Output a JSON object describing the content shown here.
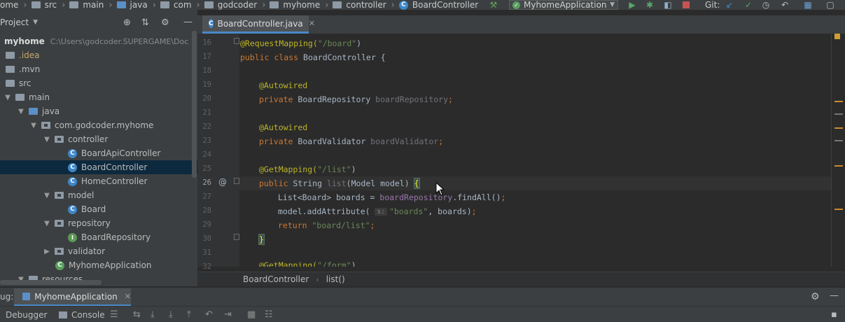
{
  "navbar": {
    "crumbs": [
      "ome",
      "src",
      "main",
      "java",
      "com",
      "godcoder",
      "myhome",
      "controller",
      "BoardController"
    ],
    "run_config": "MyhomeApplication",
    "git_label": "Git:"
  },
  "project": {
    "header": "Project",
    "root_name": "myhome",
    "root_path": "C:\\Users\\godcoder.SUPERGAME\\Doc",
    "tree": [
      {
        "label": ".idea"
      },
      {
        "label": ".mvn"
      },
      {
        "label": "src"
      },
      {
        "label": "main"
      },
      {
        "label": "java"
      },
      {
        "label": "com.godcoder.myhome"
      },
      {
        "label": "controller"
      },
      {
        "label": "BoardApiController"
      },
      {
        "label": "BoardController"
      },
      {
        "label": "HomeController"
      },
      {
        "label": "model"
      },
      {
        "label": "Board"
      },
      {
        "label": "repository"
      },
      {
        "label": "BoardRepository"
      },
      {
        "label": "validator"
      },
      {
        "label": "MyhomeApplication"
      },
      {
        "label": "resources"
      }
    ]
  },
  "editor": {
    "tab_title": "BoardController.java",
    "line_numbers": [
      "16",
      "17",
      "18",
      "19",
      "20",
      "21",
      "22",
      "23",
      "24",
      "25",
      "26",
      "27",
      "28",
      "29",
      "30",
      "31",
      "32"
    ],
    "code": {
      "l16_ann": "@RequestMapping(",
      "l16_str": "\"/board\"",
      "l16_end": ")",
      "l17_kw": "public class ",
      "l17_rest": "BoardController {",
      "l19": "@Autowired",
      "l20_kw": "private ",
      "l20_type": "BoardRepository ",
      "l20_var": "boardRepository",
      "l20_end": ";",
      "l22": "@Autowired",
      "l23_kw": "private ",
      "l23_type": "BoardValidator ",
      "l23_var": "boardValidator",
      "l23_end": ";",
      "l25_ann": "@GetMapping(",
      "l25_str": "\"/list\"",
      "l25_end": ")",
      "l26_kw": "public ",
      "l26_type": "String ",
      "l26_fn": "list",
      "l26_rest": "(Model model) ",
      "l26_brace": "{",
      "l27_a": "List<Board> boards = ",
      "l27_fld": "boardRepository",
      "l27_b": ".findAll()",
      "l27_end": ";",
      "l28_a": "model.addAttribute( ",
      "l28_hint": "s:",
      "l28_str": "\"boards\"",
      "l28_b": ", boards)",
      "l28_end": ";",
      "l29_kw": "return ",
      "l29_str": "\"board/list\"",
      "l29_end": ";",
      "l30": "}",
      "l32_ann": "@GetMapping(",
      "l32_str": "\"/form\"",
      "l32_end": ")"
    },
    "gutter_mark": "@",
    "breadcrumb": [
      "BoardController",
      "list()"
    ]
  },
  "debug": {
    "label": "ug:",
    "tab": "MyhomeApplication",
    "subtabs": [
      "Debugger",
      "Console"
    ]
  },
  "colors": {
    "accent": "#4a88c7",
    "keyword": "#cc7832",
    "annotation": "#bbb529",
    "string": "#6a8759",
    "field": "#9876aa",
    "selection": "#0d293e"
  }
}
